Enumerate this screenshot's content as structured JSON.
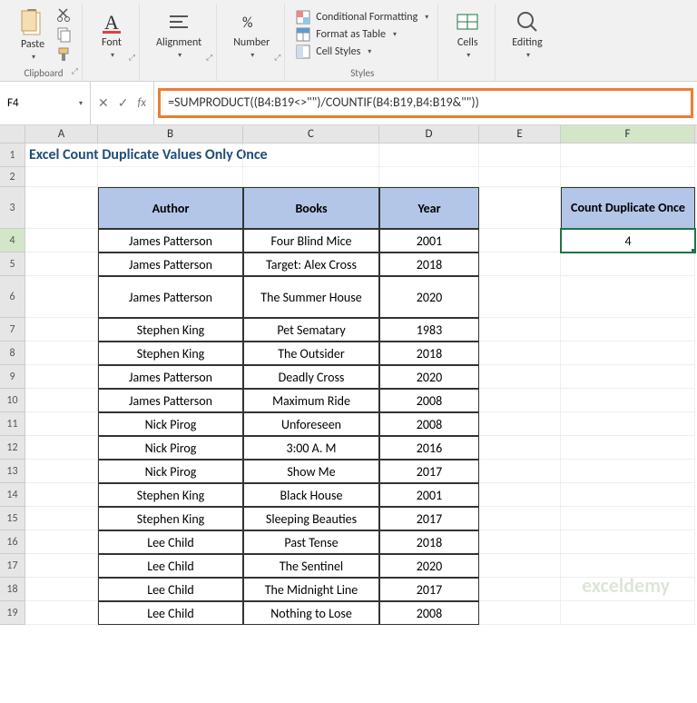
{
  "ribbon": {
    "paste": "Paste",
    "clipboard": "Clipboard",
    "font": "Font",
    "alignment": "Alignment",
    "number": "Number",
    "styles": "Styles",
    "cond_fmt": "Conditional Formatting",
    "fmt_table": "Format as Table",
    "cell_styles": "Cell Styles",
    "cells": "Cells",
    "editing": "Editing"
  },
  "namebox": "F4",
  "formula": "=SUMPRODUCT((B4:B19<>\"\")/COUNTIF(B4:B19,B4:B19&\"\"))",
  "title": "Excel Count Duplicate Values Only Once",
  "headers": {
    "author": "Author",
    "books": "Books",
    "year": "Year"
  },
  "result_header": "Count Duplicate Once",
  "result_value": "4",
  "rows": [
    {
      "a": "James Patterson",
      "b": "Four Blind Mice",
      "y": "2001"
    },
    {
      "a": "James Patterson",
      "b": "Target: Alex Cross",
      "y": "2018"
    },
    {
      "a": "James Patterson",
      "b": "The Summer House",
      "y": "2020"
    },
    {
      "a": "Stephen King",
      "b": "Pet Sematary",
      "y": "1983"
    },
    {
      "a": "Stephen King",
      "b": "The Outsider",
      "y": "2018"
    },
    {
      "a": "James Patterson",
      "b": "Deadly Cross",
      "y": "2020"
    },
    {
      "a": "James Patterson",
      "b": "Maximum Ride",
      "y": "2008"
    },
    {
      "a": "Nick Pirog",
      "b": "Unforeseen",
      "y": "2008"
    },
    {
      "a": "Nick Pirog",
      "b": "3:00 A. M",
      "y": "2016"
    },
    {
      "a": "Nick Pirog",
      "b": "Show Me",
      "y": "2017"
    },
    {
      "a": "Stephen King",
      "b": "Black House",
      "y": "2001"
    },
    {
      "a": "Stephen King",
      "b": "Sleeping Beauties",
      "y": "2017"
    },
    {
      "a": "Lee Child",
      "b": "Past Tense",
      "y": "2018"
    },
    {
      "a": "Lee Child",
      "b": "The Sentinel",
      "y": "2020"
    },
    {
      "a": "Lee Child",
      "b": "The Midnight Line",
      "y": "2017"
    },
    {
      "a": "Lee Child",
      "b": "Nothing to Lose",
      "y": "2008"
    }
  ],
  "watermark": "exceldemy"
}
